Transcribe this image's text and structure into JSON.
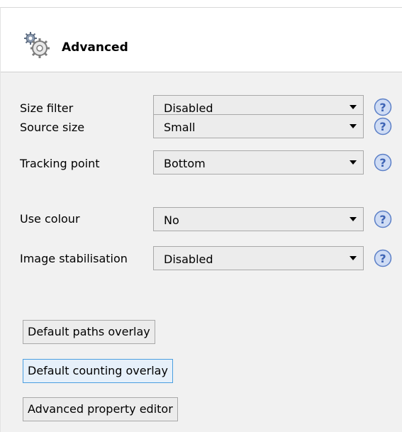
{
  "panel": {
    "title": "Advanced",
    "header_icon": "gear-icon"
  },
  "settings": [
    {
      "label": "Size filter",
      "value": "Disabled"
    },
    {
      "label": "Source size",
      "value": "Small"
    },
    {
      "label": "Tracking point",
      "value": "Bottom"
    },
    {
      "label": "Use colour",
      "value": "No"
    },
    {
      "label": "Image stabilisation",
      "value": "Disabled"
    }
  ],
  "buttons": {
    "default_paths_overlay": "Default paths overlay",
    "default_counting_overlay": "Default counting overlay",
    "advanced_property_editor": "Advanced property editor"
  },
  "colors": {
    "help_icon": "#5b7fc7",
    "focus_border": "#4a9ee0"
  }
}
